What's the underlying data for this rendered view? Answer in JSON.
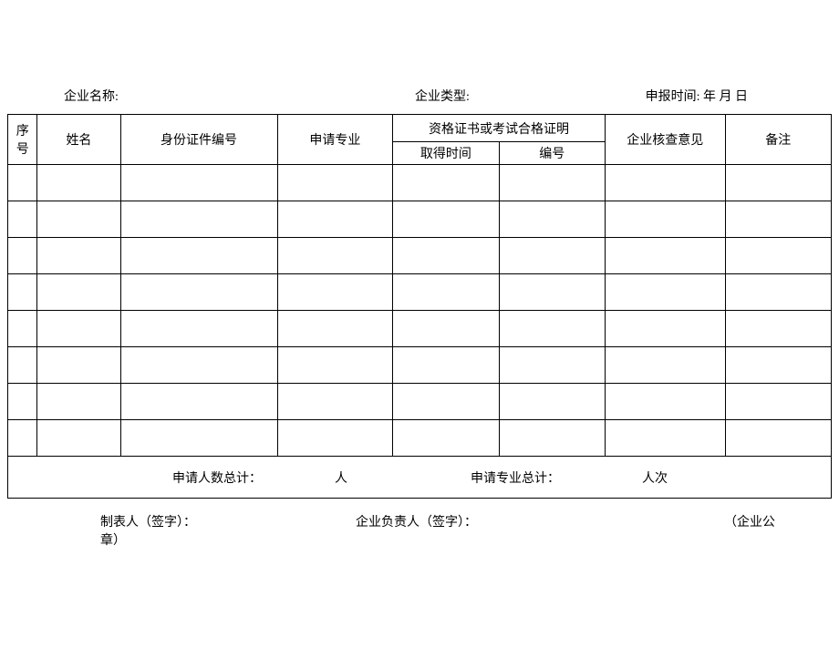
{
  "header": {
    "companyNameLabel": "企业名称:",
    "companyTypeLabel": "企业类型:",
    "reportTimeLabel": "申报时间:  年  月  日"
  },
  "table": {
    "headers": {
      "seq": "序号",
      "name": "姓名",
      "idNumber": "身份证件编号",
      "applyMajor": "申请专业",
      "certGroup": "资格证书或考试合格证明",
      "obtainTime": "取得时间",
      "certNumber": "编号",
      "companyReview": "企业核查意见",
      "notes": "备注"
    },
    "summary": {
      "totalPeopleLabel": "申请人数总计：",
      "peopleUnit": "人",
      "totalMajorLabel": "申请专业总计：",
      "majorUnit": "人次"
    }
  },
  "footer": {
    "preparerLabel": "制表人（签字）： 章）",
    "managerLabel": "企业负责人（签字）：",
    "sealLabel": "（企业公"
  }
}
